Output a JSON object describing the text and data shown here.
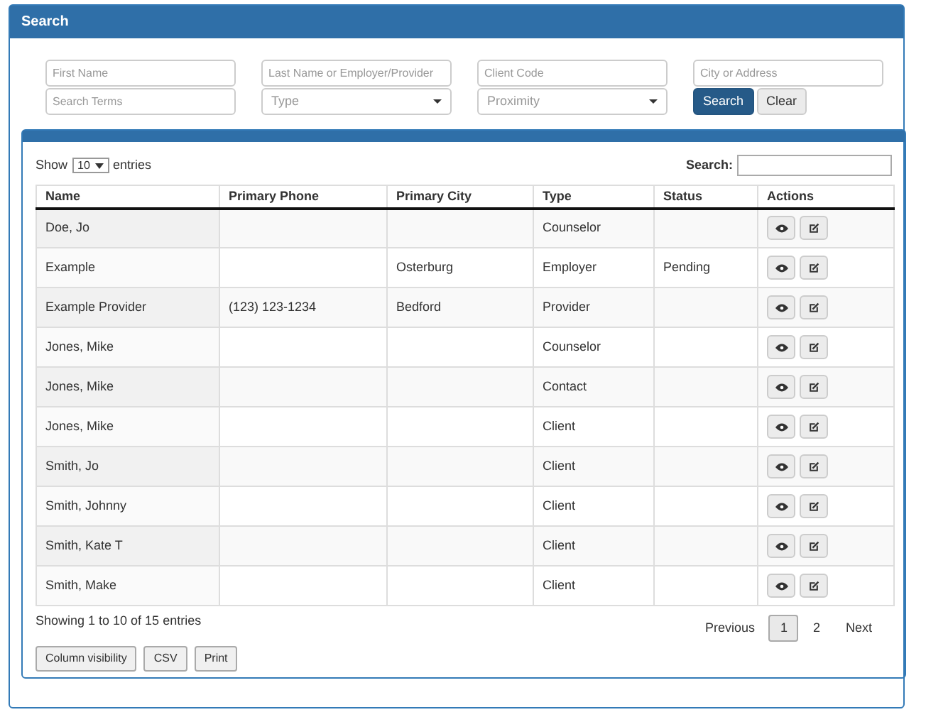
{
  "panel": {
    "title": "Search"
  },
  "filters": [
    {
      "kind": "text",
      "placeholder": "First Name"
    },
    {
      "kind": "text",
      "placeholder": "Last Name or Employer/Provider"
    },
    {
      "kind": "text",
      "placeholder": "Client Code"
    },
    {
      "kind": "text",
      "placeholder": "City or Address"
    },
    {
      "kind": "text",
      "placeholder": "Search Terms"
    },
    {
      "kind": "select",
      "placeholder": "Type"
    },
    {
      "kind": "select",
      "placeholder": "Proximity"
    }
  ],
  "filter_buttons": [
    {
      "label": "Search",
      "primary": true
    },
    {
      "label": "Clear",
      "primary": false
    }
  ],
  "length": {
    "before": "Show",
    "value": "10",
    "after": "entries"
  },
  "table_search": {
    "label": "Search:"
  },
  "table": {
    "columns": [
      "Name",
      "Primary Phone",
      "Primary City",
      "Type",
      "Status",
      "Actions"
    ],
    "rows": [
      [
        "Doe, Jo",
        "",
        "",
        "Counselor",
        ""
      ],
      [
        "Example",
        "",
        "Osterburg",
        "Employer",
        "Pending"
      ],
      [
        "Example Provider",
        "(123) 123-1234",
        "Bedford",
        "Provider",
        ""
      ],
      [
        "Jones, Mike",
        "",
        "",
        "Counselor",
        ""
      ],
      [
        "Jones, Mike",
        "",
        "",
        "Contact",
        ""
      ],
      [
        "Jones, Mike",
        "",
        "",
        "Client",
        ""
      ],
      [
        "Smith, Jo",
        "",
        "",
        "Client",
        ""
      ],
      [
        "Smith, Johnny",
        "",
        "",
        "Client",
        ""
      ],
      [
        "Smith, Kate T",
        "",
        "",
        "Client",
        ""
      ],
      [
        "Smith, Make",
        "",
        "",
        "Client",
        ""
      ]
    ]
  },
  "info": "Showing 1 to 10 of 15 entries",
  "pagination": [
    {
      "label": "Previous",
      "selected": false
    },
    {
      "label": "1",
      "selected": true
    },
    {
      "label": "2",
      "selected": false
    },
    {
      "label": "Next",
      "selected": false
    }
  ],
  "export_buttons": [
    "Column visibility",
    "CSV",
    "Print"
  ]
}
